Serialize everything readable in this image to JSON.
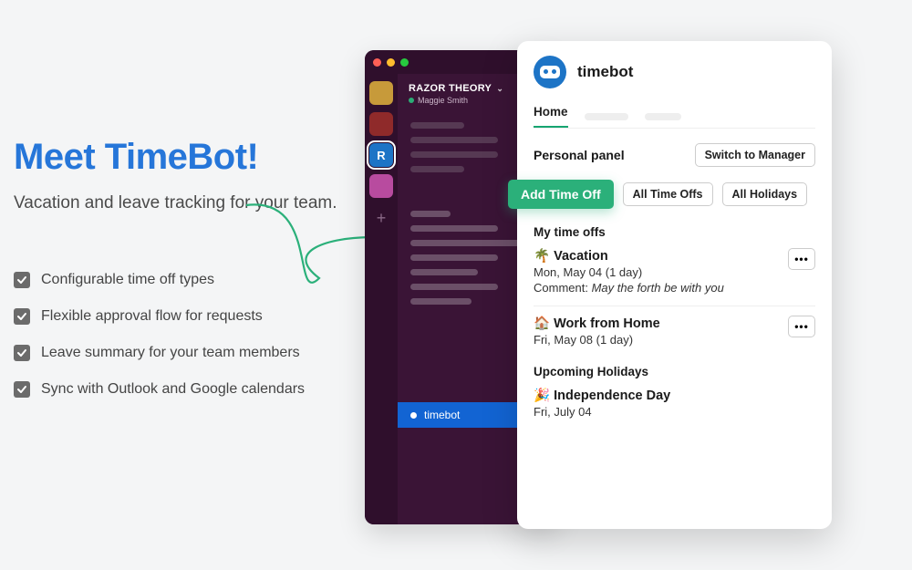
{
  "hero": {
    "title": "Meet TimeBot!",
    "subtitle": "Vacation and leave tracking for your team.",
    "features": [
      "Configurable time off types",
      "Flexible approval flow for requests",
      "Leave summary for your team members",
      "Sync with Outlook and Google calendars"
    ]
  },
  "slack": {
    "workspace": "RAZOR THEORY",
    "user": "Maggie Smith",
    "active_item": "timebot",
    "org_tiles": [
      {
        "color": "#c79a3a",
        "selected": false
      },
      {
        "color": "#8f2a2a",
        "selected": false
      },
      {
        "color": "#1d74c6",
        "selected": true,
        "letter": "R"
      },
      {
        "color": "#b84b9f",
        "selected": false
      }
    ]
  },
  "panel": {
    "title": "timebot",
    "tabs": {
      "active": "Home"
    },
    "personal_panel_label": "Personal panel",
    "switch_btn": "Switch to Manager",
    "primary_action": "Add Time Off",
    "secondary_actions": [
      "All Time Offs",
      "All Holidays"
    ],
    "timeoffs_header": "My time offs",
    "timeoffs": [
      {
        "emoji": "🌴",
        "name": "Vacation",
        "date": "Mon, May 04 (1 day)",
        "comment_label": "Comment:",
        "comment": "May the forth be with you"
      },
      {
        "emoji": "🏠",
        "name": "Work from Home",
        "date": "Fri, May 08 (1 day)"
      }
    ],
    "holidays_header": "Upcoming Holidays",
    "holidays": [
      {
        "emoji": "🎉",
        "name": "Independence Day",
        "date": "Fri, July 04"
      }
    ]
  }
}
